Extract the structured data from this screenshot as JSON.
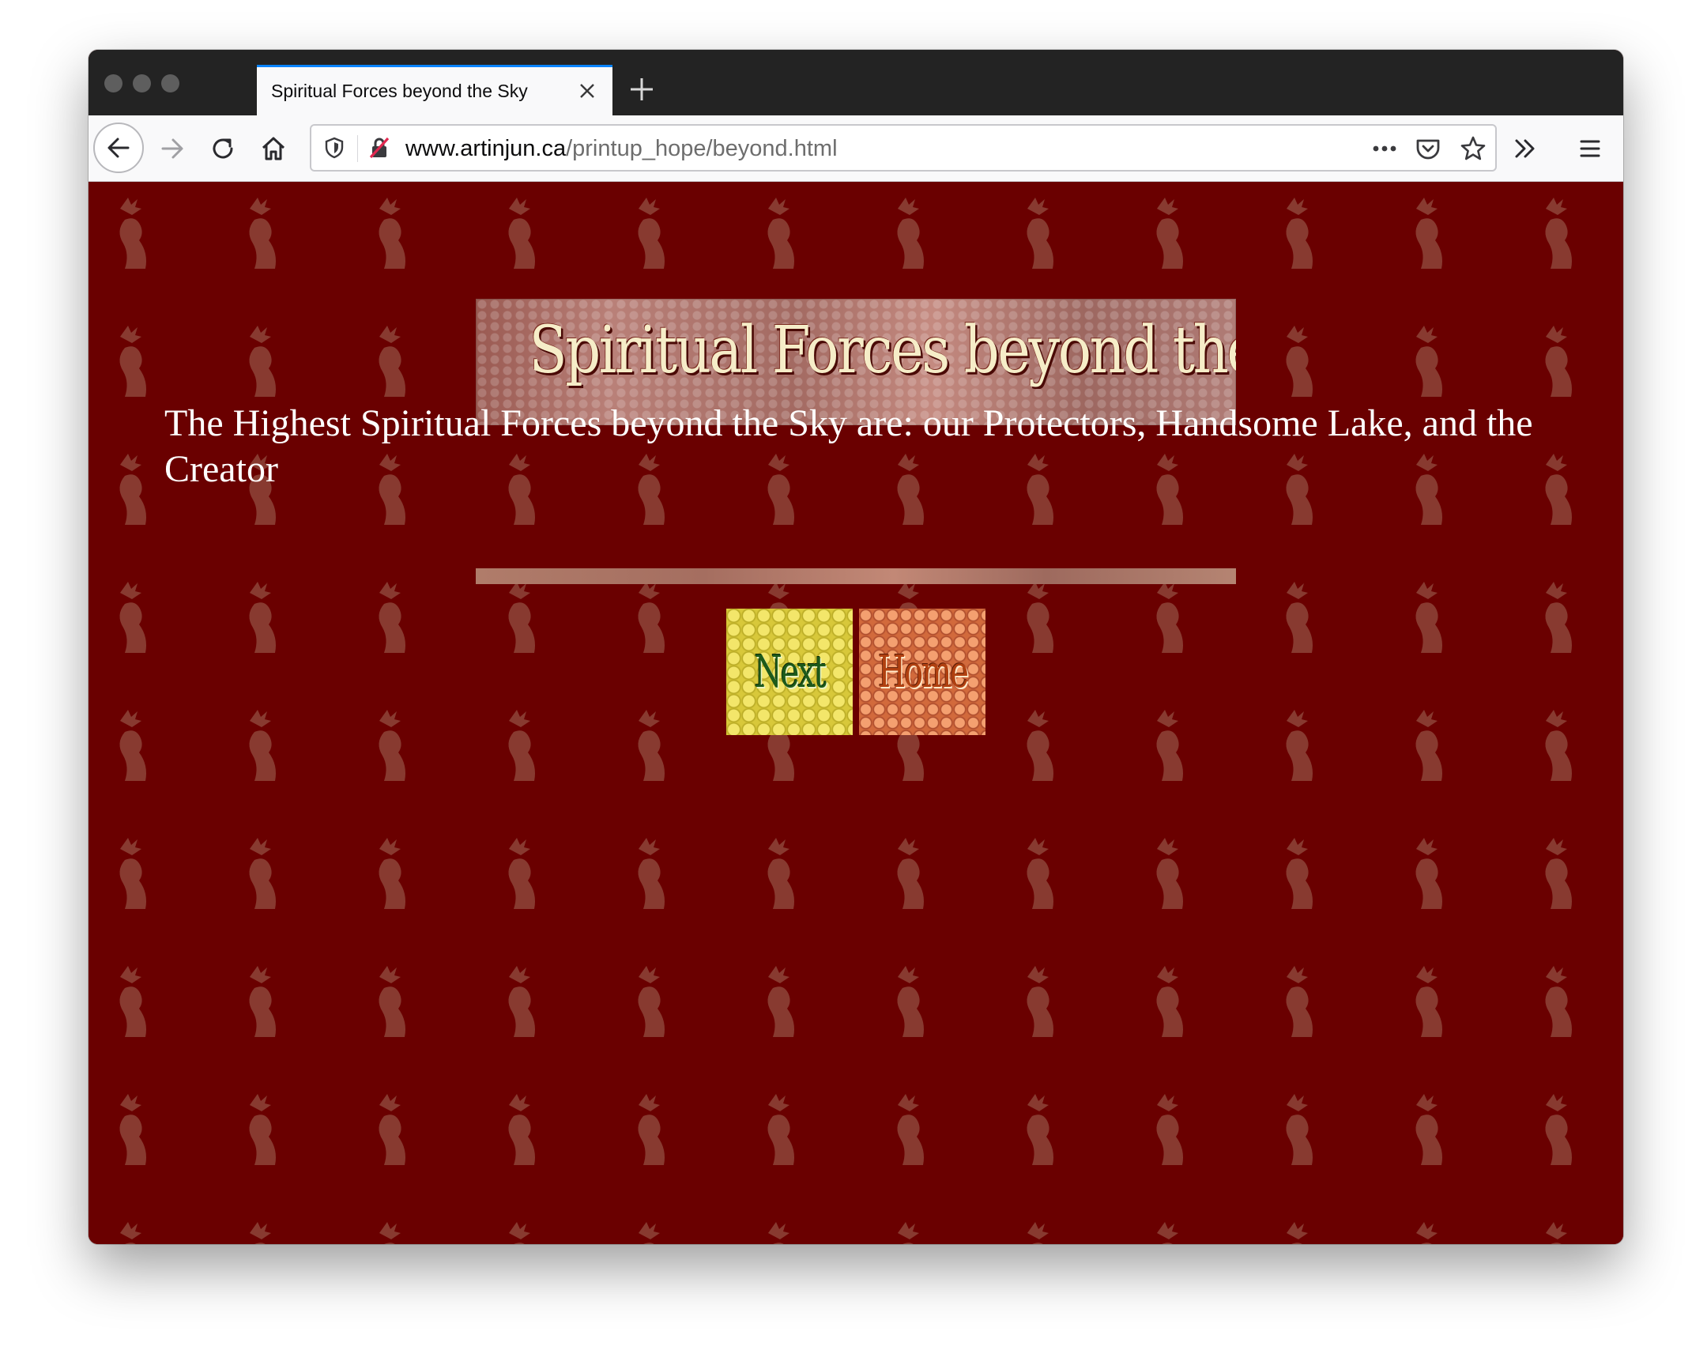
{
  "browser": {
    "tab_title": "Spiritual Forces beyond the Sky",
    "url_domain": "www.artinjun.ca",
    "url_path": "/printup_hope/beyond.html"
  },
  "page": {
    "banner_text": "Spiritual Forces beyond the Sky",
    "body_text": "The Highest Spiritual Forces beyond the Sky are: our Protectors, Handsome Lake, and the Creator",
    "next_label": "Next",
    "home_label": "Home"
  },
  "colors": {
    "page_background": "#6a0000",
    "text": "#ffffff",
    "tab_accent": "#0a84ff"
  },
  "icons": [
    "back-arrow-icon",
    "forward-arrow-icon",
    "reload-icon",
    "home-icon",
    "shield-icon",
    "insecure-lock-icon",
    "more-actions-icon",
    "pocket-icon",
    "bookmark-star-icon",
    "overflow-chevron-icon",
    "hamburger-menu-icon",
    "close-icon",
    "plus-icon"
  ]
}
